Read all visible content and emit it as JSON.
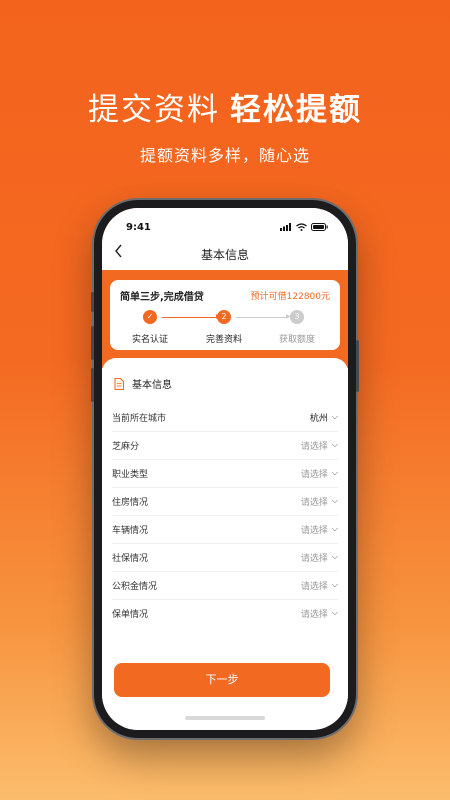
{
  "hero": {
    "title_plain": "提交资料",
    "title_bold": "轻松提额",
    "subtitle": "提额资料多样，随心选"
  },
  "status_bar": {
    "time": "9:41"
  },
  "nav": {
    "back_icon": "chevron-left-icon",
    "title": "基本信息"
  },
  "progress": {
    "title": "简单三步,完成借贷",
    "quota": "预计可借122800元",
    "steps": [
      {
        "index": "✓",
        "label": "实名认证",
        "state": "done"
      },
      {
        "index": "2",
        "label": "完善资料",
        "state": "current"
      },
      {
        "index": "3",
        "label": "获取额度",
        "state": "pending"
      }
    ]
  },
  "form": {
    "section_title": "基本信息",
    "placeholder": "请选择",
    "fields": [
      {
        "label": "当前所在城市",
        "value": "杭州"
      },
      {
        "label": "芝麻分",
        "value": "请选择"
      },
      {
        "label": "职业类型",
        "value": "请选择"
      },
      {
        "label": "住房情况",
        "value": "请选择"
      },
      {
        "label": "车辆情况",
        "value": "请选择"
      },
      {
        "label": "社保情况",
        "value": "请选择"
      },
      {
        "label": "公积金情况",
        "value": "请选择"
      },
      {
        "label": "保单情况",
        "value": "请选择"
      }
    ]
  },
  "actions": {
    "next_label": "下一步"
  },
  "colors": {
    "accent": "#f26a22",
    "pending": "#cccccc",
    "text": "#222222",
    "muted": "#999999"
  }
}
